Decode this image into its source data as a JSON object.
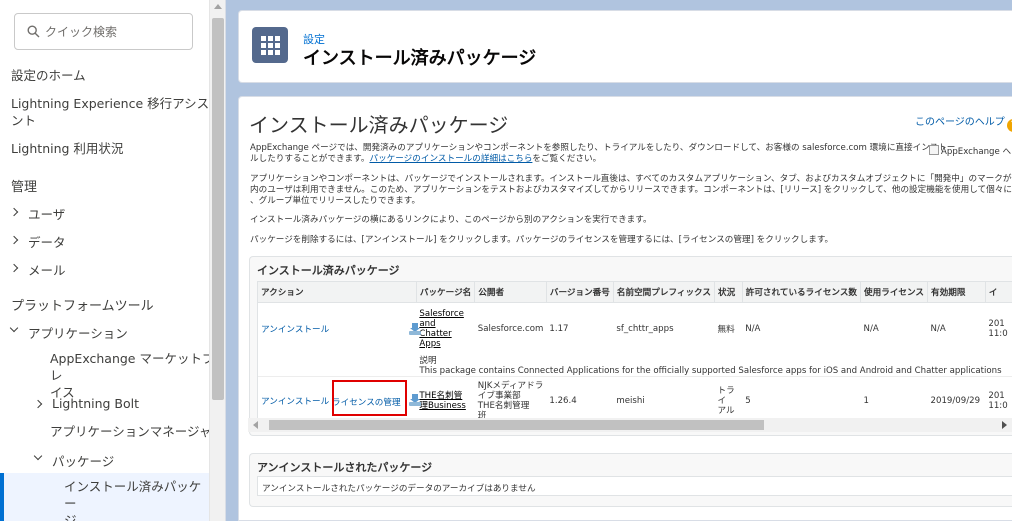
{
  "sidebar": {
    "search_placeholder": "クイック検索",
    "items": {
      "home": "設定のホーム",
      "lex_line1": "Lightning Experience 移行アシスタ",
      "lex_line2": "ント",
      "usage": "Lightning 利用状況"
    },
    "section_admin": "管理",
    "users": "ユーザ",
    "data": "データ",
    "email": "メール",
    "section_platform": "プラットフォームツール",
    "apps": "アプリケーション",
    "appexchange_line1": "AppExchange マーケットプレ",
    "appexchange_line2": "イス",
    "bolt": "Lightning Bolt",
    "app_manager": "アプリケーションマネージャ",
    "packages": "パッケージ",
    "installed_line1": "インストール済みパッケー",
    "installed_line2": "ジ"
  },
  "header": {
    "breadcrumb": "設定",
    "title": "インストール済みパッケージ"
  },
  "page": {
    "title": "インストール済みパッケージ",
    "help_link": "このページのヘルプ",
    "appexchange_img_alt": "AppExchange へ",
    "para1_line1": "AppExchange ページでは、開発済みのアプリケーションやコンポーネントを参照したり、トライアルをしたり、ダウンロードして、お客様の salesforce.com 環境に直接インストー",
    "para1_line2": "ルしたりすることができます。",
    "para1_link": "パッケージのインストールの詳細はこちら",
    "para1_tail": "をご覧ください。",
    "para2_line1": "アプリケーションやコンポーネントは、パッケージでインストールされます。インストール直後は、すべてのカスタムアプリケーション、タブ、およびカスタムオブジェクトに「開発中」のマークが付いており、組織",
    "para2_line2": "内のユーザは利用できません。このため、アプリケーションをテストおよびカスタマイズしてからリリースできます。コンポーネントは、[リリース] をクリックして、他の設定機能を使用して個々にリリースしたり",
    "para2_line3": "、グループ単位でリリースしたりできます。",
    "para3": "インストール済みパッケージの横にあるリンクにより、このページから別のアクションを実行できます。",
    "para4": "パッケージを削除するには、[アンインストール] をクリックします。パッケージのライセンスを管理するには、[ライセンスの管理] をクリックします。"
  },
  "installed": {
    "title": "インストール済みパッケージ",
    "columns": [
      "アクション",
      "パッケージ名",
      "公開者",
      "バージョン番号",
      "名前空間プレフィックス",
      "状況",
      "許可されているライセンス数",
      "使用ライセンス",
      "有効期限",
      "イ"
    ],
    "rows": [
      {
        "uninstall": "アンインストール",
        "name_lines": [
          "Salesforce",
          "and",
          "Chatter",
          "Apps"
        ],
        "publisher": "Salesforce.com",
        "version": "1.17",
        "namespace": "sf_chttr_apps",
        "status": "無料",
        "allowed": "N/A",
        "used": "N/A",
        "expires": "N/A",
        "install_lines": [
          "201",
          "11:0"
        ],
        "desc_label": "説明",
        "desc": "This package contains Connected Applications for the officially supported Salesforce apps for iOS and Android and Chatter applications"
      },
      {
        "uninstall": "アンインストール",
        "manage": "ライセンスの管理",
        "name_lines": [
          "THE名刺管",
          "理Business"
        ],
        "publisher_lines": [
          "NJKメディアドラ",
          "イブ事業部",
          "THE名刺管理",
          "班"
        ],
        "version": "1.26.4",
        "namespace": "meishi",
        "status_lines": [
          "トライ",
          "アル"
        ],
        "allowed": "5",
        "used": "1",
        "expires": "2019/09/29",
        "install_lines": [
          "201",
          "11:0"
        ]
      }
    ]
  },
  "uninstalled": {
    "title": "アンインストールされたパッケージ",
    "message": "アンインストールされたパッケージのデータのアーカイブはありません"
  }
}
